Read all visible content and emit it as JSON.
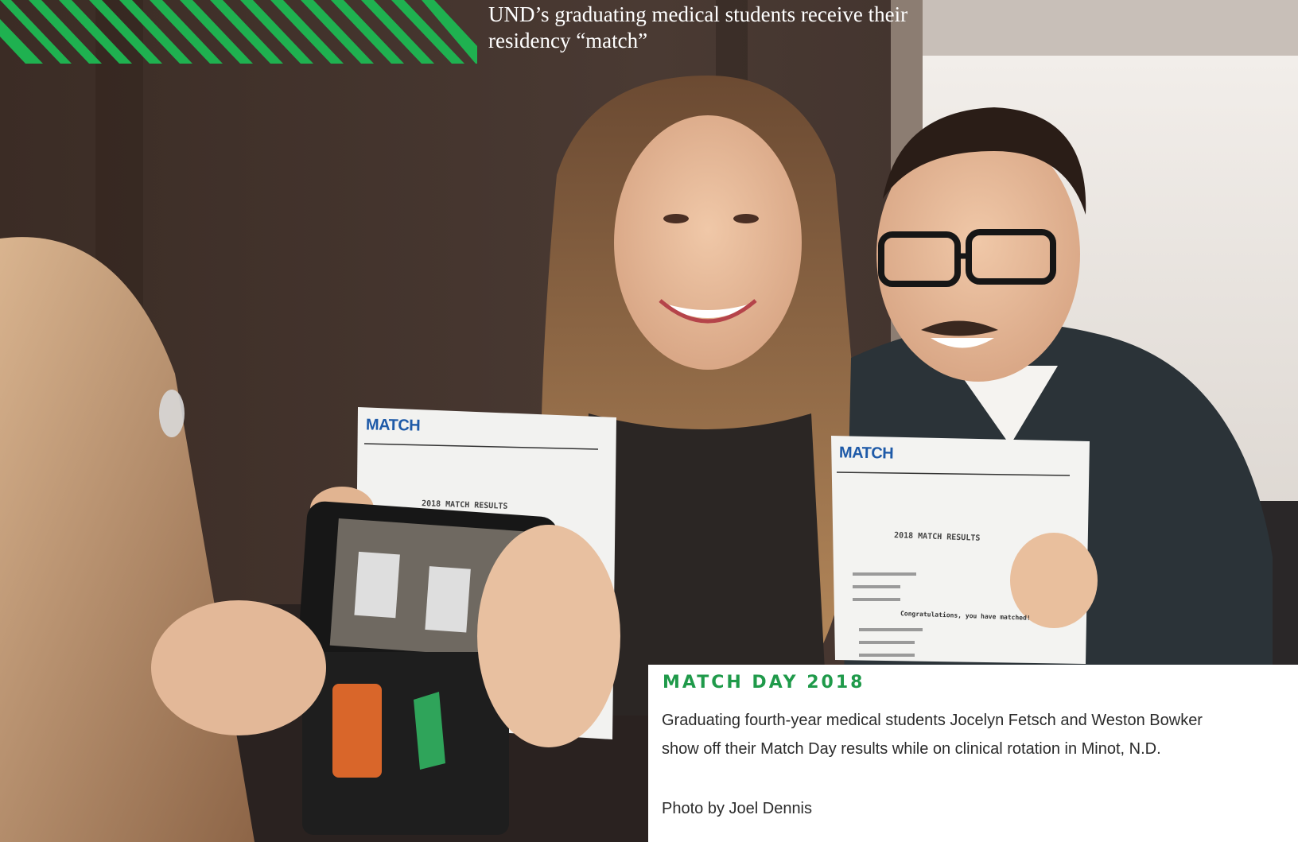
{
  "headline": "UND’s graduating medical students receive their residency “match”",
  "photo": {
    "description_icon": "photo-icon",
    "document_left": {
      "logo": "MATCH",
      "results_heading": "2018 MATCH RESULTS"
    },
    "document_right": {
      "logo": "MATCH",
      "results_heading": "2018 MATCH RESULTS",
      "congrats": "Congratulations, you have matched!"
    }
  },
  "caption": {
    "title": "MATCH DAY 2018",
    "body": "Graduating fourth-year medical students Jocelyn Fetsch and Weston Bowker show off their Match Day results while on clinical rotation in Minot, N.D.",
    "credit": "Photo by Joel Dennis"
  },
  "colors": {
    "accent_green": "#1f9a4a",
    "match_blue": "#1e5aa8"
  }
}
